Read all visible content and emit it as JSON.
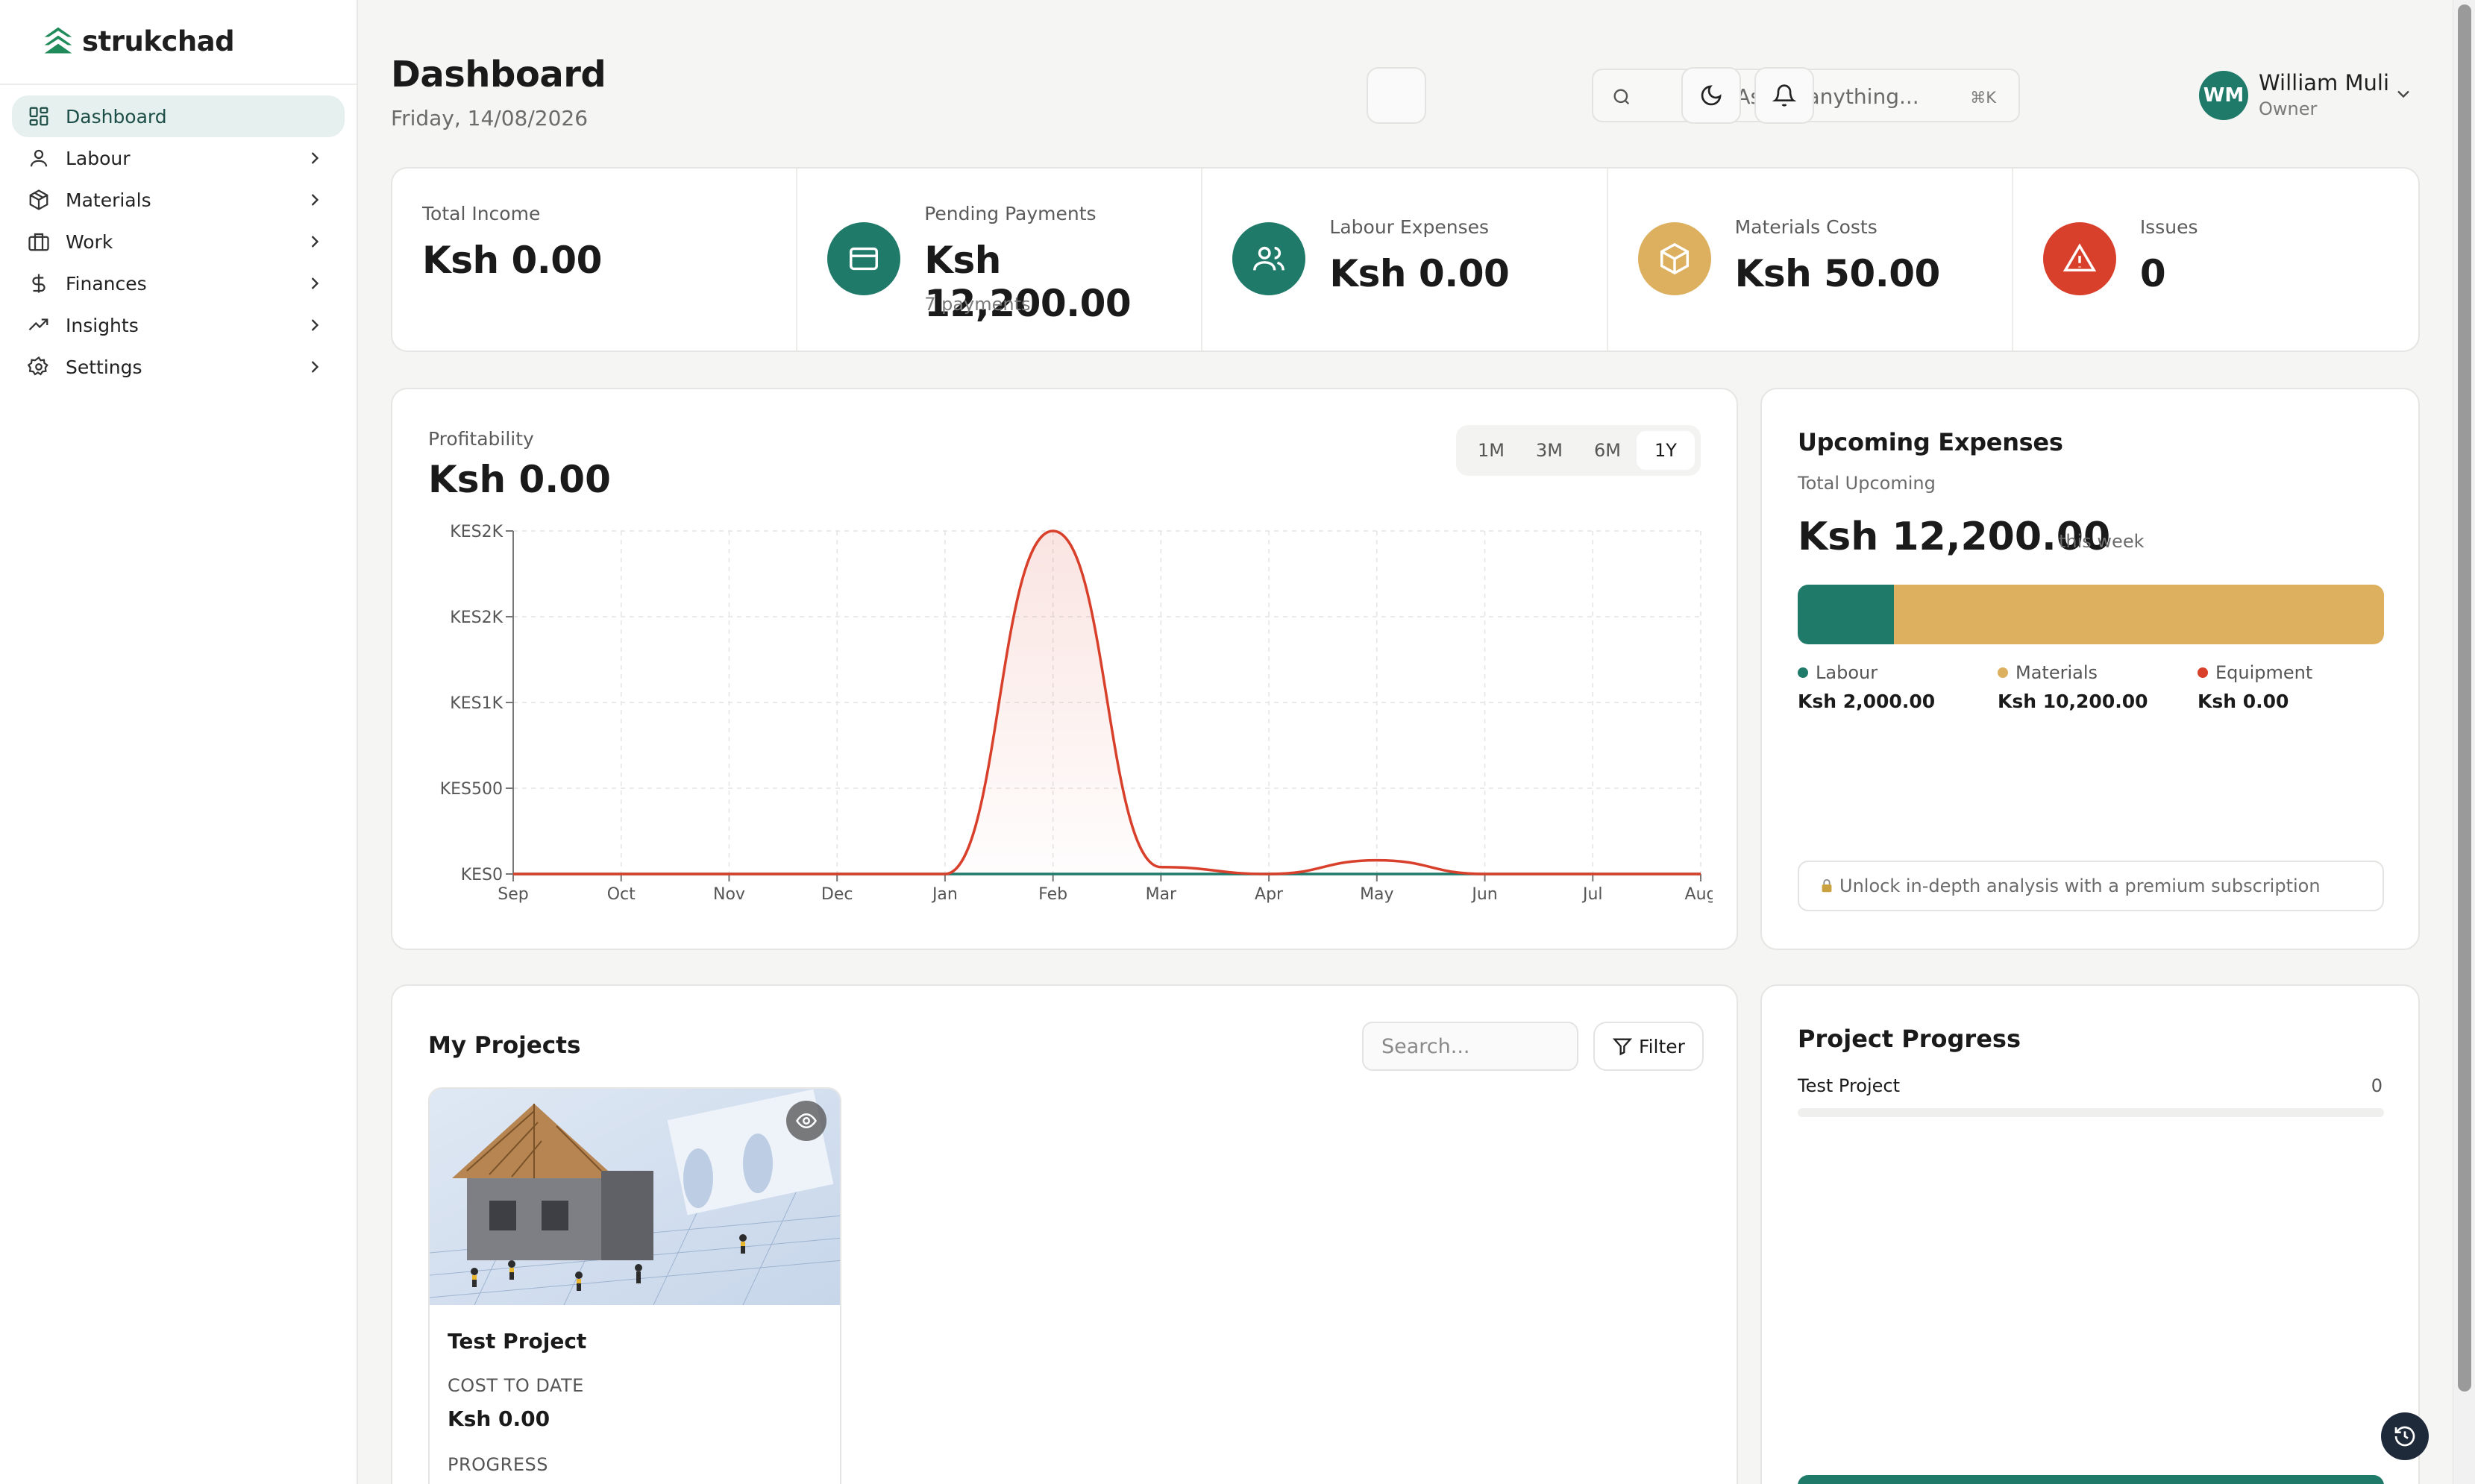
{
  "app": {
    "name": "strukchad"
  },
  "sidebar": {
    "items": [
      {
        "label": "Dashboard",
        "icon": "grid-icon",
        "active": true
      },
      {
        "label": "Labour",
        "icon": "user-icon"
      },
      {
        "label": "Materials",
        "icon": "package-icon"
      },
      {
        "label": "Work",
        "icon": "briefcase-icon"
      },
      {
        "label": "Finances",
        "icon": "dollar-icon"
      },
      {
        "label": "Insights",
        "icon": "trending-up-icon"
      },
      {
        "label": "Settings",
        "icon": "gear-icon"
      }
    ]
  },
  "header": {
    "title": "Dashboard",
    "date": "Friday, 14/08/2026",
    "search": {
      "placeholder": "Ask AI anything...",
      "shortcut": "⌘K"
    },
    "user": {
      "initials": "WM",
      "name": "William Muli",
      "role": "Owner"
    }
  },
  "stats": [
    {
      "label": "Total Income",
      "value": "Ksh 0.00"
    },
    {
      "label": "Pending Payments",
      "value": "Ksh 12,200.00",
      "sub": "7 payments",
      "icon": "credit-card-icon",
      "color": "#1f7a6a"
    },
    {
      "label": "Labour Expenses",
      "value": "Ksh 0.00",
      "icon": "users-icon",
      "color": "#1f7a6a"
    },
    {
      "label": "Materials Costs",
      "value": "Ksh 50.00",
      "icon": "box-icon",
      "color": "#ddb05f"
    },
    {
      "label": "Issues",
      "value": "0",
      "icon": "alert-triangle-icon",
      "color": "#d8402b"
    }
  ],
  "profitability": {
    "label": "Profitability",
    "value": "Ksh 0.00",
    "ranges": [
      "1M",
      "3M",
      "6M",
      "1Y"
    ],
    "active_range": "1Y"
  },
  "chart_data": {
    "type": "line",
    "categories": [
      "Sep",
      "Oct",
      "Nov",
      "Dec",
      "Jan",
      "Feb",
      "Mar",
      "Apr",
      "May",
      "Jun",
      "Jul",
      "Aug"
    ],
    "series": [
      {
        "values": [
          0,
          0,
          0,
          0,
          0,
          2000,
          40,
          0,
          80,
          0,
          0,
          0
        ],
        "color": "#d8402b"
      },
      {
        "values": [
          0,
          0,
          0,
          0,
          0,
          0,
          0,
          0,
          0,
          0,
          0,
          0
        ],
        "color": "#1f7a6a"
      }
    ],
    "y_ticks": [
      {
        "value": 0,
        "label": "KES0"
      },
      {
        "value": 500,
        "label": "KES500"
      },
      {
        "value": 1000,
        "label": "KES1K"
      },
      {
        "value": 1500,
        "label": "KES2K"
      },
      {
        "value": 2000,
        "label": "KES2K"
      }
    ],
    "ylim": [
      0,
      2000
    ],
    "grid": true
  },
  "upcoming": {
    "title": "Upcoming Expenses",
    "subtitle": "Total Upcoming",
    "value": "Ksh 12,200.00",
    "period": "this week",
    "segments": [
      {
        "name": "Labour",
        "amount": 2000,
        "value": "Ksh 2,000.00",
        "color": "#1f7a6a"
      },
      {
        "name": "Materials",
        "amount": 10200,
        "value": "Ksh 10,200.00",
        "color": "#ddb05f"
      },
      {
        "name": "Equipment",
        "amount": 0,
        "value": "Ksh 0.00",
        "color": "#d8402b"
      }
    ],
    "premium_text": "Unlock in-depth analysis with a premium subscription"
  },
  "projects": {
    "title": "My Projects",
    "search_placeholder": "Search...",
    "filter_label": "Filter",
    "items": [
      {
        "name": "Test Project",
        "cost_label": "COST TO DATE",
        "cost": "Ksh 0.00",
        "progress_label": "PROGRESS"
      }
    ]
  },
  "progress": {
    "title": "Project Progress",
    "items": [
      {
        "name": "Test Project",
        "value": "0",
        "percent": 0
      }
    ]
  }
}
